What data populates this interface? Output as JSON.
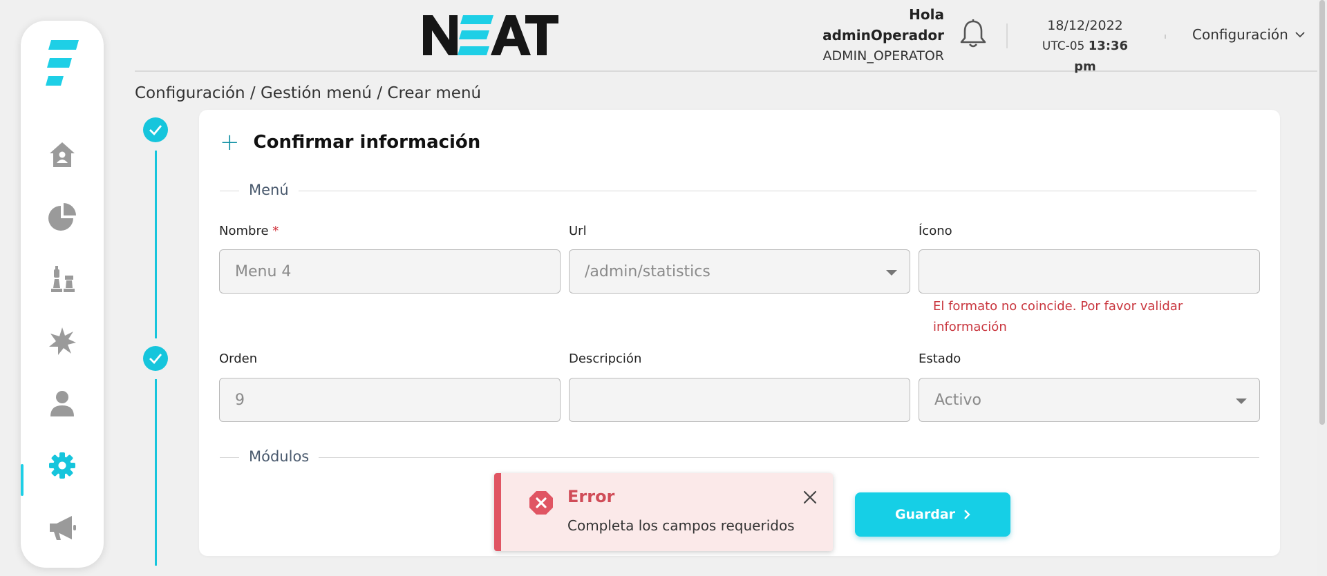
{
  "app": {
    "brand": "NEAT"
  },
  "header": {
    "greeting": "Hola",
    "username": "adminOperador",
    "role": "ADMIN_OPERATOR",
    "date": "18/12/2022",
    "timezone": "UTC-05",
    "time": "13:36 pm",
    "config_label": "Configuración"
  },
  "sidebar": {
    "items": [
      {
        "name": "home",
        "icon": "home-icon"
      },
      {
        "name": "statistics",
        "icon": "pie-chart-icon"
      },
      {
        "name": "strategy",
        "icon": "chess-icon"
      },
      {
        "name": "events",
        "icon": "burst-icon"
      },
      {
        "name": "users",
        "icon": "user-icon"
      },
      {
        "name": "settings",
        "icon": "gear-icon",
        "active": true
      },
      {
        "name": "campaigns",
        "icon": "megaphone-icon"
      }
    ]
  },
  "breadcrumb": "Configuración / Gestión menú / Crear menú",
  "card": {
    "title": "Confirmar información",
    "section_menu": "Menú",
    "section_modules": "Módulos",
    "fields": {
      "nombre": {
        "label": "Nombre",
        "required_mark": "*",
        "value": "Menu 4"
      },
      "url": {
        "label": "Url",
        "value": "/admin/statistics"
      },
      "icono": {
        "label": "Ícono",
        "value": "",
        "error": "El formato no coincide. Por favor validar información"
      },
      "orden": {
        "label": "Orden",
        "value": "9"
      },
      "descripcion": {
        "label": "Descripción",
        "value": ""
      },
      "estado": {
        "label": "Estado",
        "value": "Activo"
      }
    }
  },
  "toast": {
    "title": "Error",
    "message": "Completa los campos requeridos"
  },
  "actions": {
    "save_label": "Guardar"
  },
  "colors": {
    "accent": "#16cfe6",
    "error": "#d04c58",
    "sidebar_icon": "#9a9a9a"
  }
}
